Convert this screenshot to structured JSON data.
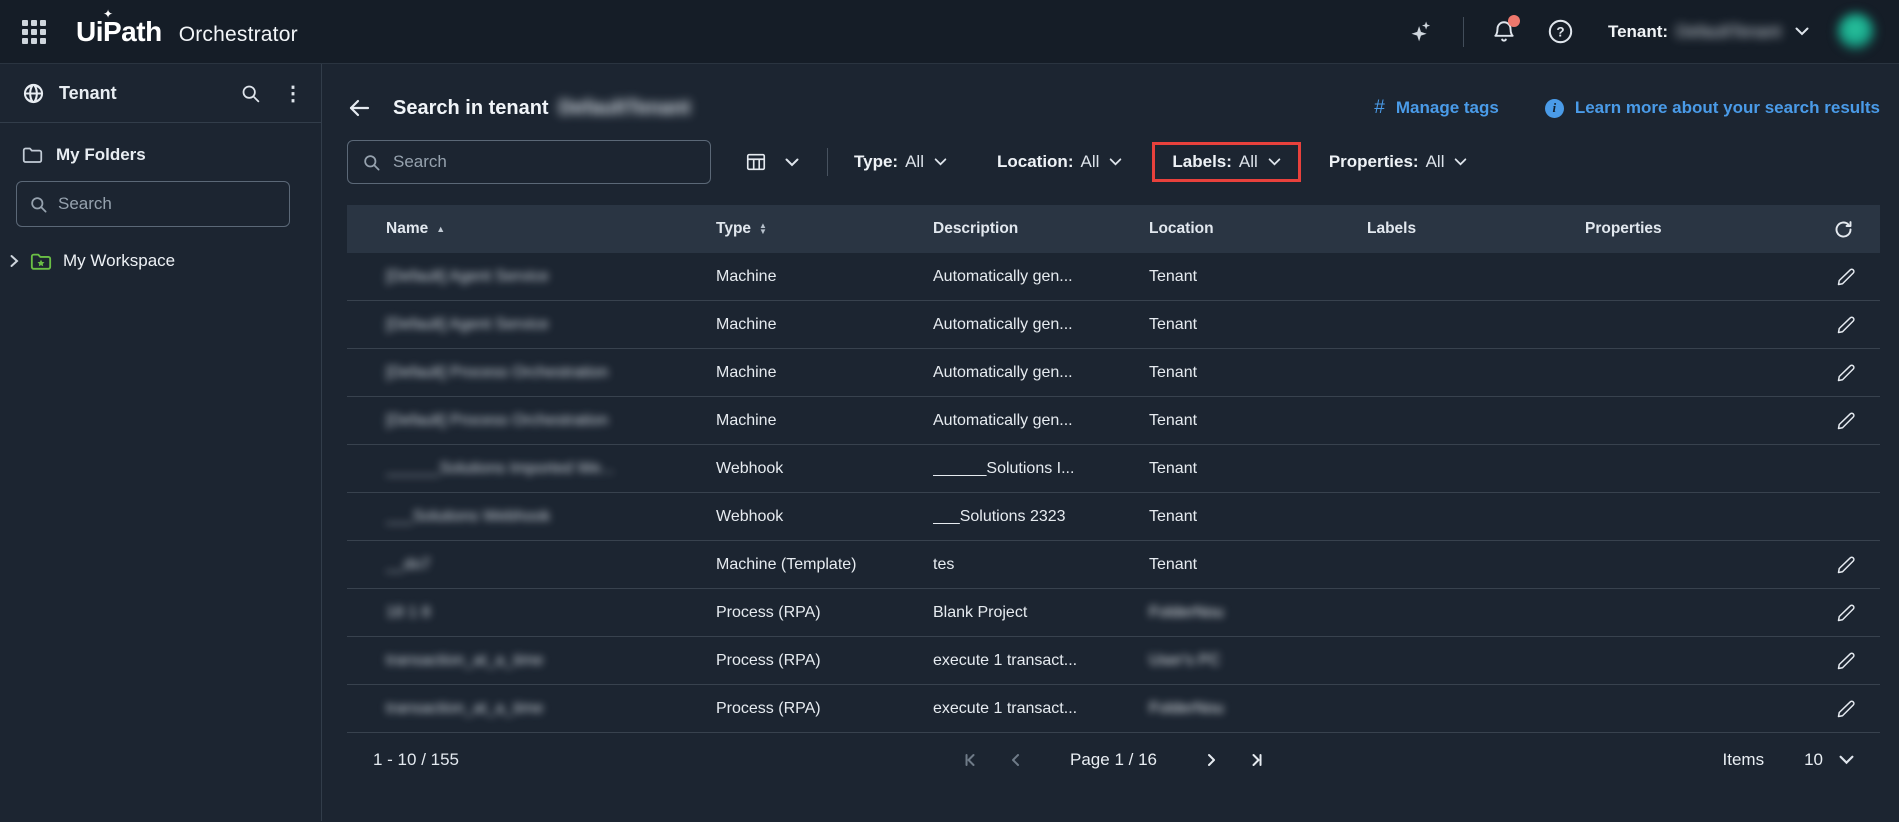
{
  "colors": {
    "accent_blue": "#4a9be8",
    "highlight_red": "#e8413c",
    "avatar_teal": "#17a78b",
    "notification_dot": "#ee786d",
    "folder_green": "#6abf45"
  },
  "topbar": {
    "product": "UiPath",
    "app": "Orchestrator",
    "tenant_label": "Tenant:",
    "tenant_name": "DefaultTenant"
  },
  "sidebar": {
    "panel_title": "Tenant",
    "my_folders_label": "My Folders",
    "search_placeholder": "Search",
    "workspace_label": "My Workspace"
  },
  "header": {
    "back": "←",
    "title": "Search in tenant",
    "tenant_name": "DefaultTenant",
    "manage_tags_label": "Manage tags",
    "learn_more_label": "Learn more about your search results"
  },
  "filters": {
    "search_placeholder": "Search",
    "items": [
      {
        "label": "Type:",
        "value": "All",
        "highlighted": false
      },
      {
        "label": "Location:",
        "value": "All",
        "highlighted": false
      },
      {
        "label": "Labels:",
        "value": "All",
        "highlighted": true
      },
      {
        "label": "Properties:",
        "value": "All",
        "highlighted": false
      }
    ]
  },
  "table": {
    "columns": [
      "Name",
      "Type",
      "Description",
      "Location",
      "Labels",
      "Properties"
    ],
    "name_sort": "asc",
    "rows": [
      {
        "name": "[Default] Agent Service",
        "name_redacted": true,
        "type": "Machine",
        "description": "Automatically gen...",
        "location": "Tenant",
        "location_redacted": false,
        "editable": true
      },
      {
        "name": "[Default] Agent Service",
        "name_redacted": true,
        "type": "Machine",
        "description": "Automatically gen...",
        "location": "Tenant",
        "location_redacted": false,
        "editable": true
      },
      {
        "name": "[Default] Process Orchestration",
        "name_redacted": true,
        "type": "Machine",
        "description": "Automatically gen...",
        "location": "Tenant",
        "location_redacted": false,
        "editable": true
      },
      {
        "name": "[Default] Process Orchestration",
        "name_redacted": true,
        "type": "Machine",
        "description": "Automatically gen...",
        "location": "Tenant",
        "location_redacted": false,
        "editable": true
      },
      {
        "name": "______Solutions Imported We...",
        "name_redacted": true,
        "type": "Webhook",
        "description": "______Solutions I...",
        "location": "Tenant",
        "location_redacted": false,
        "editable": false
      },
      {
        "name": "___Solutions Webhook",
        "name_redacted": true,
        "type": "Webhook",
        "description": "___Solutions 2323",
        "location": "Tenant",
        "location_redacted": false,
        "editable": false
      },
      {
        "name": "__do7",
        "name_redacted": true,
        "type": "Machine (Template)",
        "description": "tes",
        "location": "Tenant",
        "location_redacted": false,
        "editable": true
      },
      {
        "name": "18 1 8",
        "name_redacted": true,
        "type": "Process (RPA)",
        "description": "Blank Project",
        "location": "FolderNou",
        "location_redacted": true,
        "editable": true
      },
      {
        "name": "transaction_at_a_time",
        "name_redacted": true,
        "type": "Process (RPA)",
        "description": "execute 1 transact...",
        "location": "User's PC",
        "location_redacted": true,
        "editable": true
      },
      {
        "name": "transaction_at_a_time",
        "name_redacted": true,
        "type": "Process (RPA)",
        "description": "execute 1 transact...",
        "location": "FolderNou",
        "location_redacted": true,
        "editable": true
      }
    ]
  },
  "footer": {
    "range": "1 - 10 / 155",
    "page": "Page 1 / 16",
    "items_label": "Items",
    "items_value": "10"
  }
}
